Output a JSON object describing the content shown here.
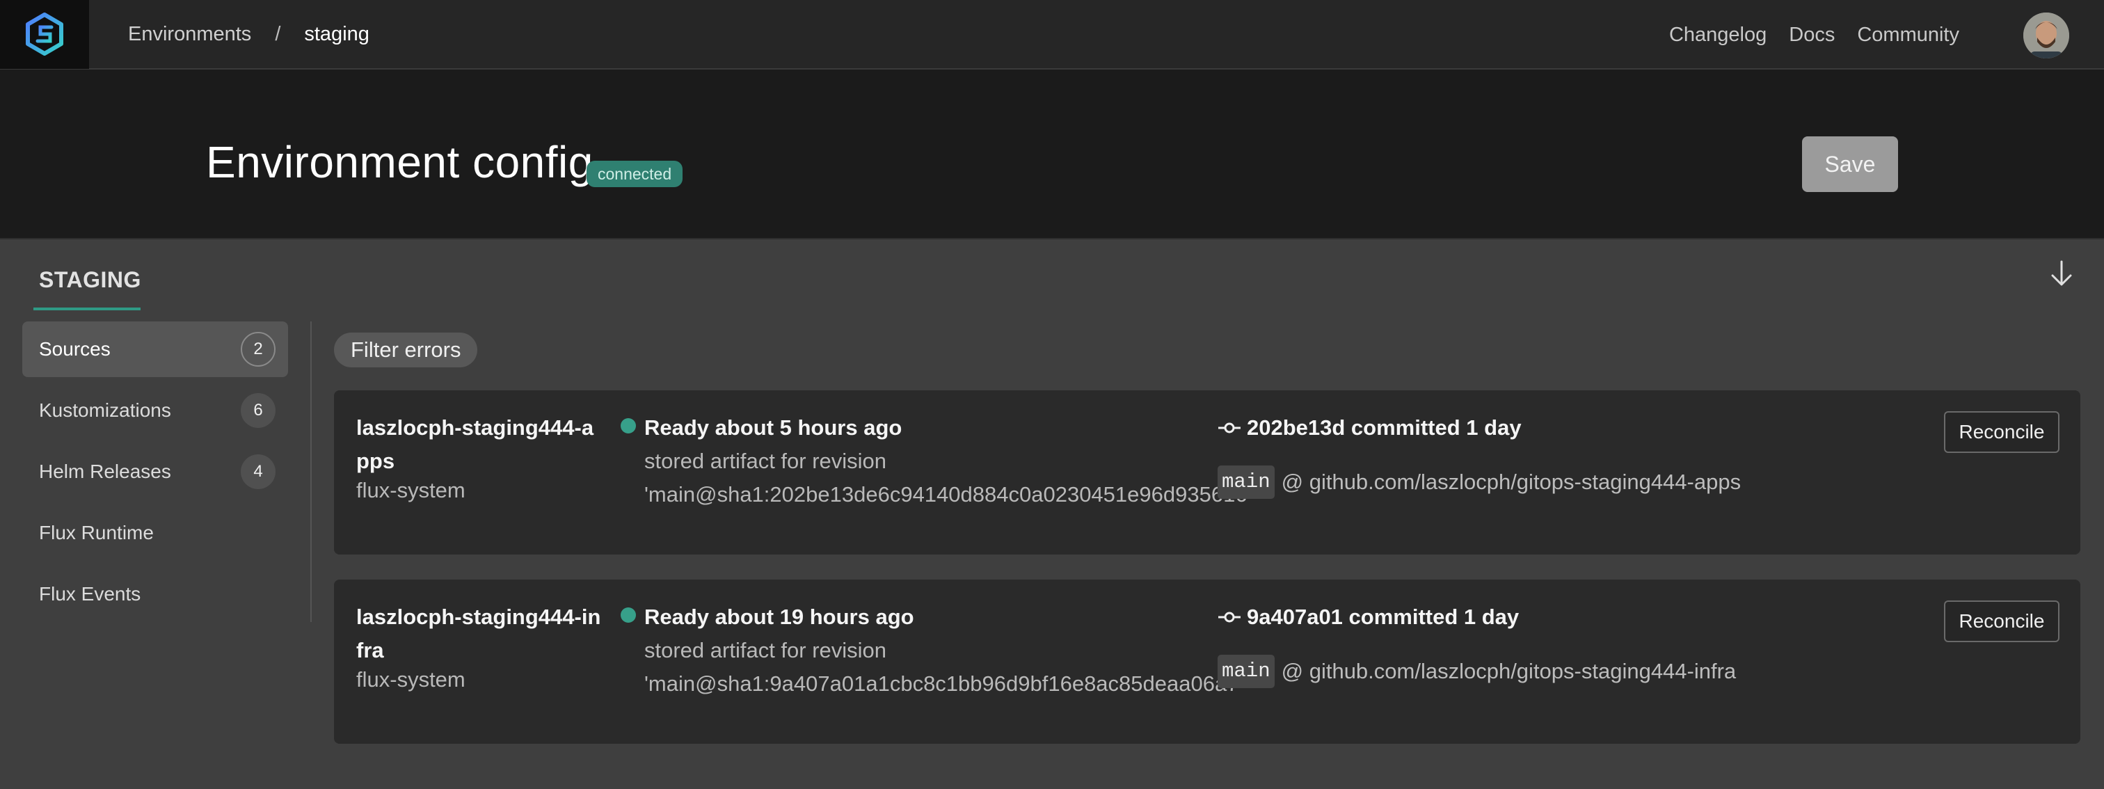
{
  "nav": {
    "breadcrumb_parent": "Environments",
    "breadcrumb_sep": "/",
    "breadcrumb_current": "staging",
    "links": [
      "Changelog",
      "Docs",
      "Community"
    ]
  },
  "header": {
    "title": "Environment config",
    "status": "connected",
    "save_label": "Save"
  },
  "section": {
    "tab": "STAGING"
  },
  "sidebar": {
    "items": [
      {
        "label": "Sources",
        "count": "2",
        "active": true
      },
      {
        "label": "Kustomizations",
        "count": "6"
      },
      {
        "label": "Helm Releases",
        "count": "4"
      },
      {
        "label": "Flux Runtime"
      },
      {
        "label": "Flux Events"
      }
    ]
  },
  "filter": {
    "label": "Filter errors"
  },
  "sources": [
    {
      "name": "laszlocph-staging444-apps",
      "namespace": "flux-system",
      "ready": "Ready about 5 hours ago",
      "artifact_line1": "stored artifact for revision",
      "artifact_line2": "'main@sha1:202be13de6c94140d884c0a0230451e96d935616'",
      "commit": "202be13d committed 1 day",
      "branch": "main",
      "repo": "@ github.com/laszlocph/gitops-staging444-apps",
      "reconcile_label": "Reconcile"
    },
    {
      "name": "laszlocph-staging444-infra",
      "namespace": "flux-system",
      "ready": "Ready about 19 hours ago",
      "artifact_line1": "stored artifact for revision",
      "artifact_line2": "'main@sha1:9a407a01a1cbc8c1bb96d9bf16e8ac85deaa06a7'",
      "commit": "9a407a01 committed 1 day",
      "branch": "main",
      "repo": "@ github.com/laszlocph/gitops-staging444-infra",
      "reconcile_label": "Reconcile"
    }
  ],
  "colors": {
    "accent": "#2f9a85",
    "ready_dot": "#37a08a",
    "badge_bg": "#2f8071"
  }
}
